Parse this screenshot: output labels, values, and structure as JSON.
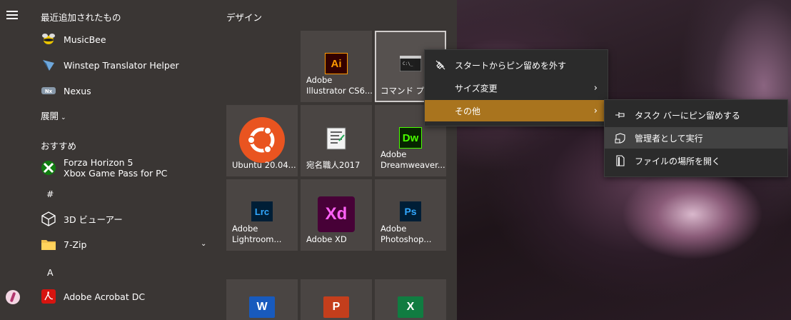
{
  "start_menu": {
    "recently_added_title": "最近追加されたもの",
    "recent_apps": [
      {
        "name": "MusicBee",
        "icon": "musicbee-icon"
      },
      {
        "name": "Winstep Translator Helper",
        "icon": "winstep-icon"
      },
      {
        "name": "Nexus",
        "icon": "nexus-icon"
      }
    ],
    "expand_label": "展開",
    "recommended_title": "おすすめ",
    "recommended_app": {
      "line1": "Forza Horizon 5",
      "line2": "Xbox Game Pass for PC",
      "icon": "xbox-icon"
    },
    "hash_header": "#",
    "apps_hash": [
      {
        "name": "3D ビューアー",
        "icon": "cube-icon"
      },
      {
        "name": "7-Zip",
        "icon": "folder-icon"
      }
    ],
    "a_header": "A",
    "apps_a": [
      {
        "name": "Adobe Acrobat DC",
        "icon": "acrobat-icon"
      }
    ]
  },
  "tiles": {
    "group_title": "デザイン",
    "illustrator": {
      "line1": "Adobe",
      "line2": "Illustrator CS6...",
      "badge": "Ai"
    },
    "cmd": {
      "label": "コマンド プロンプト"
    },
    "ubuntu": {
      "label": "Ubuntu 20.04..."
    },
    "atena": {
      "label": "宛名職人2017"
    },
    "dreamweaver": {
      "line1": "Adobe",
      "line2": "Dreamweaver...",
      "badge": "Dw"
    },
    "lightroom": {
      "line1": "Adobe",
      "line2": "Lightroom...",
      "badge": "Lrc"
    },
    "xd": {
      "label": "Adobe XD",
      "badge": "Xd"
    },
    "photoshop": {
      "line1": "Adobe",
      "line2": "Photoshop...",
      "badge": "Ps"
    },
    "word_badge": "W",
    "ppt_badge": "P",
    "excel_badge": "X"
  },
  "context_menu": {
    "unpin": "スタートからピン留めを外す",
    "resize": "サイズ変更",
    "more": "その他"
  },
  "submenu": {
    "pin_taskbar": "タスク バーにピン留めする",
    "run_admin": "管理者として実行",
    "open_location": "ファイルの場所を開く"
  },
  "colors": {
    "accent": "#a9741e",
    "illustrator": "#ff9a00",
    "dreamweaver": "#4aff00",
    "lightroom": "#31a8ff",
    "xd": "#ff61f6",
    "photoshop": "#31a8ff",
    "ubuntu": "#e95420"
  }
}
